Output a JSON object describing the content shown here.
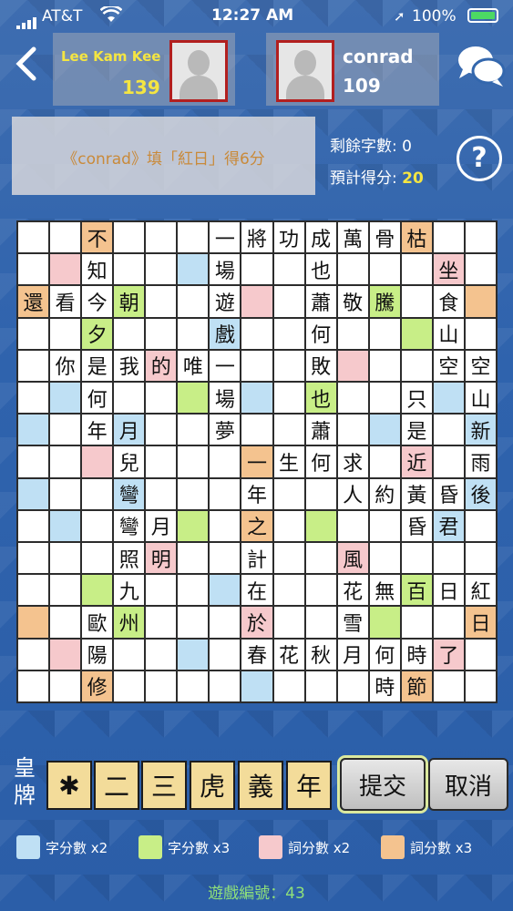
{
  "status": {
    "carrier": "AT&T",
    "time": "12:27 AM",
    "battery": "100%"
  },
  "colors": {
    "blue": "#bfe0f4",
    "green": "#c8ee87",
    "pink": "#f6c9cc",
    "orange": "#f4c38f",
    "accent": "#f4e542"
  },
  "player1": {
    "name": "Lee Kam Kee",
    "score": "139"
  },
  "player2": {
    "name": "conrad",
    "score": "109"
  },
  "message": "《conrad》填「紅日」得6分",
  "remaining": "剩餘字數: 0",
  "estimate_label": "預計得分: ",
  "estimate_value": "20",
  "help": "?",
  "board": {
    "rows": [
      [
        "",
        "",
        "不",
        "",
        "",
        "",
        "一",
        "將",
        "功",
        "成",
        "萬",
        "骨",
        "枯",
        "",
        ""
      ],
      [
        "",
        "",
        "知",
        "",
        "",
        "",
        "場",
        "",
        "",
        "也",
        "",
        "",
        "",
        "坐",
        ""
      ],
      [
        "還",
        "看",
        "今",
        "朝",
        "",
        "",
        "遊",
        "",
        "",
        "蕭",
        "敬",
        "騰",
        "",
        "食",
        ""
      ],
      [
        "",
        "",
        "夕",
        "",
        "",
        "",
        "戲",
        "",
        "",
        "何",
        "",
        "",
        "",
        "山",
        ""
      ],
      [
        "",
        "你",
        "是",
        "我",
        "的",
        "唯",
        "一",
        "",
        "",
        "敗",
        "",
        "",
        "",
        "空",
        "空"
      ],
      [
        "",
        "",
        "何",
        "",
        "",
        "",
        "場",
        "",
        "",
        "也",
        "",
        "",
        "只",
        "",
        "山"
      ],
      [
        "",
        "",
        "年",
        "月",
        "",
        "",
        "夢",
        "",
        "",
        "蕭",
        "",
        "",
        "是",
        "",
        "新"
      ],
      [
        "",
        "",
        "",
        "兒",
        "",
        "",
        "",
        "一",
        "生",
        "何",
        "求",
        "",
        "近",
        "",
        "雨"
      ],
      [
        "",
        "",
        "",
        "彎",
        "",
        "",
        "",
        "年",
        "",
        "",
        "人",
        "約",
        "黃",
        "昏",
        "後"
      ],
      [
        "",
        "",
        "",
        "彎",
        "月",
        "",
        "",
        "之",
        "",
        "",
        "",
        "",
        "昏",
        "君",
        ""
      ],
      [
        "",
        "",
        "",
        "照",
        "明",
        "",
        "",
        "計",
        "",
        "",
        "風",
        "",
        "",
        "",
        ""
      ],
      [
        "",
        "",
        "",
        "九",
        "",
        "",
        "",
        "在",
        "",
        "",
        "花",
        "無",
        "百",
        "日",
        "紅"
      ],
      [
        "",
        "",
        "歐",
        "州",
        "",
        "",
        "",
        "於",
        "",
        "",
        "雪",
        "",
        "",
        "",
        "日"
      ],
      [
        "",
        "",
        "陽",
        "",
        "",
        "",
        "",
        "春",
        "花",
        "秋",
        "月",
        "何",
        "時",
        "了",
        ""
      ],
      [
        "",
        "",
        "修",
        "",
        "",
        "",
        "",
        "",
        "",
        "",
        "",
        "時",
        "節",
        "",
        ""
      ]
    ],
    "colors": [
      [
        "",
        "",
        "o",
        "",
        "",
        "",
        "",
        "",
        "",
        "",
        "",
        "",
        "o",
        "",
        ""
      ],
      [
        "",
        "p",
        "",
        "",
        "",
        "b",
        "",
        "",
        "",
        "",
        "",
        "",
        "",
        "p",
        ""
      ],
      [
        "o",
        "",
        "",
        "g",
        "",
        "",
        "",
        "p",
        "",
        "",
        "",
        "g",
        "",
        "",
        "o"
      ],
      [
        "",
        "",
        "g",
        "",
        "",
        "",
        "b",
        "",
        "",
        "",
        "",
        "",
        "g",
        "",
        ""
      ],
      [
        "",
        "",
        "",
        "",
        "p",
        "",
        "",
        "",
        "",
        "",
        "p",
        "",
        "",
        "",
        ""
      ],
      [
        "",
        "b",
        "",
        "",
        "",
        "g",
        "",
        "b",
        "",
        "g",
        "",
        "",
        "",
        "b",
        ""
      ],
      [
        "b",
        "",
        "",
        "b",
        "",
        "",
        "",
        "",
        "",
        "",
        "",
        "b",
        "",
        "",
        "b"
      ],
      [
        "",
        "",
        "p",
        "",
        "",
        "",
        "",
        "o",
        "",
        "",
        "",
        "",
        "p",
        "",
        ""
      ],
      [
        "b",
        "",
        "",
        "b",
        "",
        "",
        "",
        "",
        "",
        "",
        "",
        "",
        "",
        "",
        "b"
      ],
      [
        "",
        "b",
        "",
        "",
        "",
        "g",
        "",
        "o",
        "",
        "g",
        "",
        "",
        "",
        "b",
        ""
      ],
      [
        "",
        "",
        "",
        "",
        "p",
        "",
        "",
        "",
        "",
        "",
        "p",
        "",
        "",
        "",
        ""
      ],
      [
        "",
        "",
        "g",
        "",
        "",
        "",
        "b",
        "",
        "",
        "",
        "",
        "",
        "g",
        "",
        ""
      ],
      [
        "o",
        "",
        "",
        "g",
        "",
        "",
        "",
        "p",
        "",
        "",
        "",
        "g",
        "",
        "",
        "o"
      ],
      [
        "",
        "p",
        "",
        "",
        "",
        "b",
        "",
        "",
        "",
        "",
        "",
        "",
        "",
        "p",
        ""
      ],
      [
        "",
        "",
        "o",
        "",
        "",
        "",
        "",
        "b",
        "",
        "",
        "",
        "",
        "o",
        "",
        ""
      ]
    ]
  },
  "rack": {
    "label": "皇牌",
    "tiles": [
      "✱",
      "二",
      "三",
      "虎",
      "義",
      "年"
    ]
  },
  "buttons": {
    "submit": "提交",
    "cancel": "取消"
  },
  "legend": [
    {
      "color": "blue",
      "label": "字分數 x2"
    },
    {
      "color": "green",
      "label": "字分數 x3"
    },
    {
      "color": "pink",
      "label": "詞分數 x2"
    },
    {
      "color": "orange",
      "label": "詞分數 x3"
    }
  ],
  "game_number": "遊戲編號：43"
}
